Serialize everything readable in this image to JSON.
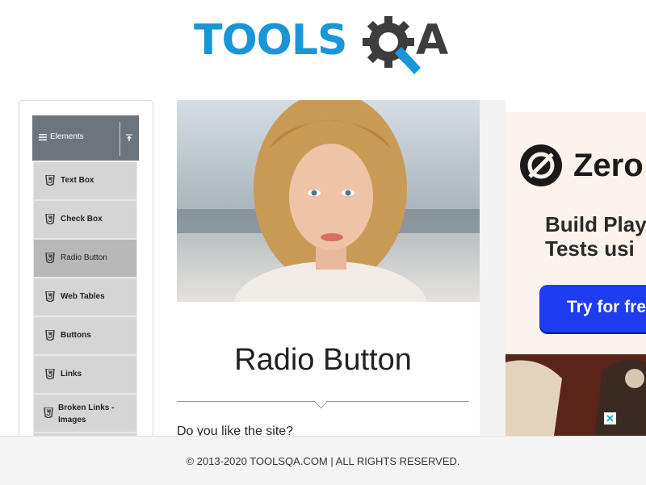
{
  "header": {
    "logo_text": "TOOLS",
    "logo_suffix": "A",
    "logo_name": "TOOLSQA"
  },
  "sidebar": {
    "group_label": "Elements",
    "items": [
      {
        "label": "Text Box"
      },
      {
        "label": "Check Box"
      },
      {
        "label": "Radio Button",
        "active": true
      },
      {
        "label": "Web Tables"
      },
      {
        "label": "Buttons"
      },
      {
        "label": "Links"
      },
      {
        "label": "Broken Links - Images"
      }
    ]
  },
  "main": {
    "title": "Radio Button",
    "question": "Do you like the site?"
  },
  "ad": {
    "brand": "Zero",
    "headline": "Build Playw\nTests usi",
    "cta": "Try for fre",
    "close": "✕"
  },
  "footer": {
    "text": "© 2013-2020 TOOLSQA.COM | ALL RIGHTS RESERVED."
  },
  "colors": {
    "brand_blue": "#1996d8",
    "sidebar_header": "#6c757d",
    "sidebar_item": "#d5d5d5",
    "sidebar_item_active": "#b8b8b8",
    "ad_cta": "#1e3cf0"
  }
}
